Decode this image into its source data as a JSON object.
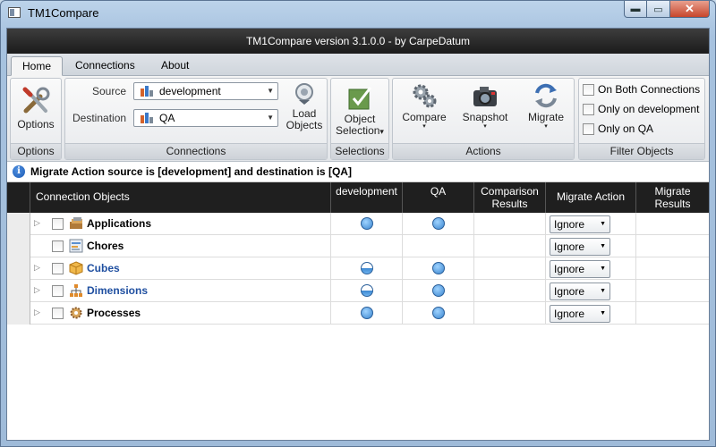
{
  "window": {
    "title": "TM1Compare",
    "minimize_glyph": "▬",
    "maximize_glyph": "▭",
    "close_glyph": "✕"
  },
  "header": {
    "title": "TM1Compare version 3.1.0.0 - by CarpeDatum"
  },
  "tabs": [
    "Home",
    "Connections",
    "About"
  ],
  "ribbon": {
    "options": {
      "button_label": "Options",
      "group_label": "Options",
      "icon": "tools-icon"
    },
    "connections": {
      "source_label": "Source",
      "source_value": "development",
      "destination_label": "Destination",
      "destination_value": "QA",
      "load_line1": "Load",
      "load_line2": "Objects",
      "group_label": "Connections"
    },
    "selections": {
      "line1": "Object",
      "line2": "Selection",
      "dd_glyph": "▾",
      "group_label": "Selections"
    },
    "actions": {
      "compare_label": "Compare",
      "snapshot_label": "Snapshot",
      "migrate_label": "Migrate",
      "dd_glyph": "▾",
      "group_label": "Actions"
    },
    "filter": {
      "options": [
        "On Both Connections",
        "Only on development",
        "Only on QA"
      ],
      "group_label": "Filter Objects"
    }
  },
  "info": {
    "icon_glyph": "i",
    "message": "Migrate Action source is [development] and destination is [QA]"
  },
  "grid": {
    "columns": {
      "objects": "Connection Objects",
      "source": "development",
      "dest": "QA",
      "comparison_line1": "Comparison",
      "comparison_line2": "Results",
      "action": "Migrate Action",
      "results_line1": "Migrate",
      "results_line2": "Results"
    },
    "expander_glyph": "▷",
    "dropdown_glyph": "▼",
    "rows": [
      {
        "name": "Applications",
        "expandable": true,
        "style": "bold",
        "source": "full",
        "dest": "full",
        "action": "Ignore",
        "icon": "applications-icon"
      },
      {
        "name": "Chores",
        "expandable": false,
        "style": "bold",
        "source": "none",
        "dest": "none",
        "action": "Ignore",
        "icon": "chores-icon"
      },
      {
        "name": "Cubes",
        "expandable": true,
        "style": "blue",
        "source": "half",
        "dest": "full",
        "action": "Ignore",
        "icon": "cubes-icon"
      },
      {
        "name": "Dimensions",
        "expandable": true,
        "style": "blue",
        "source": "half",
        "dest": "full",
        "action": "Ignore",
        "icon": "dimensions-icon"
      },
      {
        "name": "Processes",
        "expandable": true,
        "style": "bold",
        "source": "full",
        "dest": "full",
        "action": "Ignore",
        "icon": "processes-icon"
      }
    ]
  },
  "colors": {
    "header_bg": "#1f1f1f",
    "link_blue": "#1f4fa0",
    "dot_blue": "#3a85cf"
  }
}
